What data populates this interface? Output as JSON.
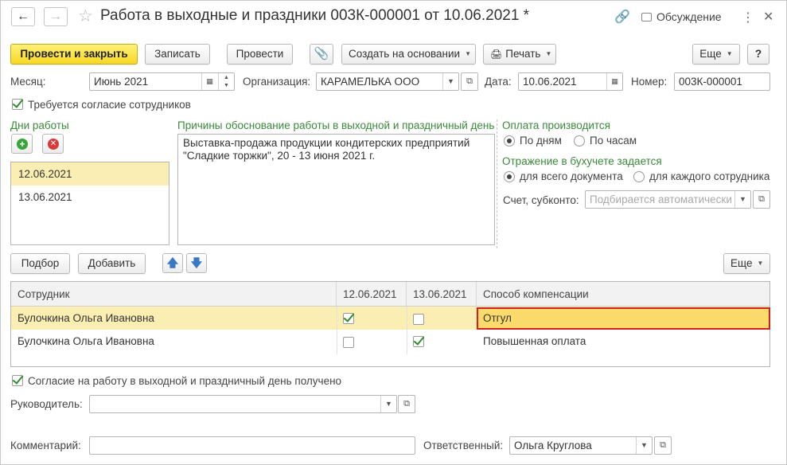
{
  "window": {
    "title": "Работа в выходные и праздники 003К-000001 от 10.06.2021 *",
    "discussion_label": "Обсуждение"
  },
  "toolbar": {
    "post_close": "Провести и закрыть",
    "save": "Записать",
    "post": "Провести",
    "create_based": "Создать на основании",
    "print": "Печать",
    "more": "Еще",
    "help": "?"
  },
  "header_fields": {
    "month_label": "Месяц:",
    "month_value": "Июнь 2021",
    "org_label": "Организация:",
    "org_value": "КАРАМЕЛЬКА ООО",
    "date_label": "Дата:",
    "date_value": "10.06.2021",
    "number_label": "Номер:",
    "number_value": "003К-000001"
  },
  "consent_required": {
    "label": "Требуется согласие сотрудников",
    "checked": true
  },
  "work_days": {
    "title": "Дни работы",
    "items": [
      "12.06.2021",
      "13.06.2021"
    ],
    "selected_index": 0
  },
  "reasons": {
    "title": "Причины обоснование работы в выходной и праздничный день",
    "text_line1": "Выставка-продажа продукции кондитерских предприятий",
    "text_line2": "\"Сладкие торжки\", 20 - 13 июня 2021 г."
  },
  "payment": {
    "title": "Оплата производится",
    "option_days": "По дням",
    "option_hours": "По часам",
    "selected": "По дням"
  },
  "accounting": {
    "title": "Отражение в бухучете задается",
    "option_doc": "для всего документа",
    "option_employee": "для каждого сотрудника",
    "selected": "для всего документа",
    "account_label": "Счет, субконто:",
    "account_placeholder": "Подбирается автоматически"
  },
  "table_toolbar": {
    "pick": "Подбор",
    "add": "Добавить",
    "more": "Еще"
  },
  "table": {
    "columns": [
      "Сотрудник",
      "12.06.2021",
      "13.06.2021",
      "Способ компенсации"
    ],
    "rows": [
      {
        "employee": "Булочкина Ольга Ивановна",
        "d1": true,
        "d2": false,
        "compensation": "Отгул"
      },
      {
        "employee": "Булочкина Ольга Ивановна",
        "d1": false,
        "d2": true,
        "compensation": "Повышенная оплата"
      }
    ]
  },
  "consent_received": {
    "label": "Согласие на работу в выходной и праздничный день получено",
    "checked": true
  },
  "footer": {
    "manager_label": "Руководитель:",
    "manager_value": "",
    "comment_label": "Комментарий:",
    "comment_value": "",
    "responsible_label": "Ответственный:",
    "responsible_value": "Ольга Круглова"
  },
  "colors": {
    "primary_button": "#f7d824",
    "selection": "#fbeeb3",
    "group_title": "#3a8a3a",
    "active_cell_border": "#d02020"
  }
}
